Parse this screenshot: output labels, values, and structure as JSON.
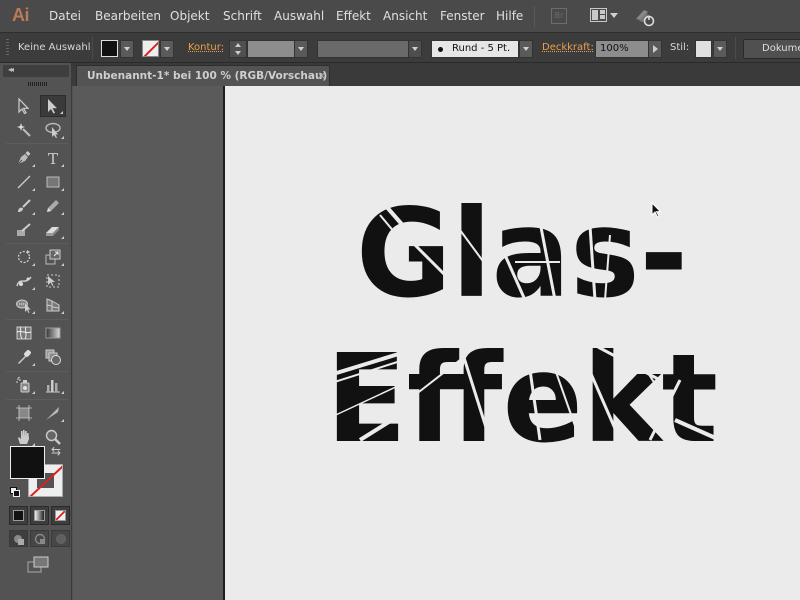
{
  "app": {
    "logo": "Ai",
    "menu": [
      "Datei",
      "Bearbeiten",
      "Objekt",
      "Schrift",
      "Auswahl",
      "Effekt",
      "Ansicht",
      "Fenster",
      "Hilfe"
    ],
    "bridge_label": "Br",
    "icons": [
      "bridge-icon",
      "workspace-switcher-icon",
      "sync-settings-icon"
    ]
  },
  "control_bar": {
    "selection_label": "Keine Auswahl",
    "fill_color": "#111111",
    "stroke_color": "none",
    "stroke_label": "Kontur:",
    "stroke_weight": "",
    "variable_width": "",
    "brush_label": "Rund - 5 Pt.",
    "opacity_label": "Deckkraft:",
    "opacity_value": "100%",
    "style_label": "Stil:",
    "document_button": "Dokume"
  },
  "tools_panel": {
    "collapse_label": "◂◂",
    "tools": [
      {
        "name": "selection-tool",
        "active": false
      },
      {
        "name": "direct-selection-tool",
        "active": true
      },
      {
        "name": "magic-wand-tool",
        "active": false
      },
      {
        "name": "lasso-tool",
        "active": false
      },
      {
        "name": "pen-tool",
        "active": false
      },
      {
        "name": "type-tool",
        "active": false
      },
      {
        "name": "line-segment-tool",
        "active": false
      },
      {
        "name": "rectangle-tool",
        "active": false
      },
      {
        "name": "paintbrush-tool",
        "active": false
      },
      {
        "name": "pencil-tool",
        "active": false
      },
      {
        "name": "blob-brush-tool",
        "active": false
      },
      {
        "name": "eraser-tool",
        "active": false
      },
      {
        "name": "rotate-tool",
        "active": false
      },
      {
        "name": "scale-tool",
        "active": false
      },
      {
        "name": "width-tool",
        "active": false
      },
      {
        "name": "free-transform-tool",
        "active": false
      },
      {
        "name": "shape-builder-tool",
        "active": false
      },
      {
        "name": "perspective-grid-tool",
        "active": false
      },
      {
        "name": "mesh-tool",
        "active": false
      },
      {
        "name": "gradient-tool",
        "active": false
      },
      {
        "name": "eyedropper-tool",
        "active": false
      },
      {
        "name": "blend-tool",
        "active": false
      },
      {
        "name": "symbol-sprayer-tool",
        "active": false
      },
      {
        "name": "column-graph-tool",
        "active": false
      },
      {
        "name": "artboard-tool",
        "active": false
      },
      {
        "name": "slice-tool",
        "active": false
      },
      {
        "name": "hand-tool",
        "active": false
      },
      {
        "name": "zoom-tool",
        "active": false
      }
    ],
    "fill_color": "#111111",
    "stroke_color": "none",
    "type_label": "T"
  },
  "document": {
    "tab_title": "Unbenannt-1* bei 100 % (RGB/Vorschau)",
    "close_glyph": "×",
    "artwork_text": [
      "Glas-",
      "Effekt"
    ],
    "artwork_effect": "shattered glass",
    "artboard_color": "#ebebeb",
    "text_color": "#111111"
  }
}
